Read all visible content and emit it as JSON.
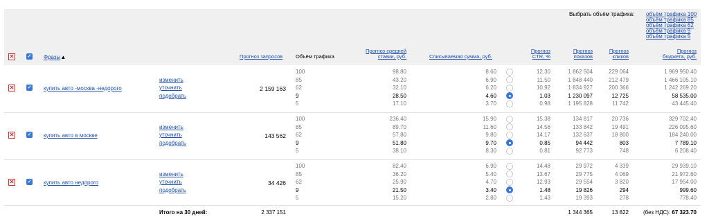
{
  "traffic_select": {
    "label": "Выбрать объём трафика:",
    "options": [
      "объём трафика 100",
      "объём трафика 85",
      "объём трафика 62",
      "объём трафика 9",
      "объём трафика 5"
    ]
  },
  "header": {
    "phrases": "Фразы",
    "sort_arrow": "▲",
    "requests": "Прогноз запросов",
    "traffic": "Объём трафика",
    "bid": [
      "Прогноз средней",
      "ставки, руб."
    ],
    "charged": "Списываемая сумма, руб.",
    "ctr": [
      "Прогноз",
      "CTR, %"
    ],
    "impressions": [
      "Прогноз",
      "показов"
    ],
    "clicks": [
      "Прогноз",
      "кликов"
    ],
    "budget": [
      "Прогноз",
      "бюджета, руб."
    ]
  },
  "actions": {
    "change": "изменить",
    "refine": "уточнить",
    "pick": "подобрать"
  },
  "phrases": [
    {
      "name": "купить авто -москва -недорого",
      "requests": "2 159 163",
      "rows": [
        {
          "traffic": "100",
          "bid": "98.80",
          "charged": "8.60",
          "ctr": "12.30",
          "impressions": "1 862 504",
          "clicks": "229 064",
          "budget": "1 969 950.40"
        },
        {
          "traffic": "85",
          "bid": "43.20",
          "charged": "6.90",
          "ctr": "11.50",
          "impressions": "1 848 440",
          "clicks": "212 479",
          "budget": "1 466 105.10"
        },
        {
          "traffic": "62",
          "bid": "32.10",
          "charged": "6.20",
          "ctr": "10.92",
          "impressions": "1 834 927",
          "clicks": "200 366",
          "budget": "1 242 269.20"
        },
        {
          "traffic": "9",
          "bid": "28.50",
          "charged": "4.60",
          "ctr": "1.03",
          "impressions": "1 230 097",
          "clicks": "12 725",
          "budget": "58 535.00"
        },
        {
          "traffic": "5",
          "bid": "17.10",
          "charged": "3.70",
          "ctr": "0.98",
          "impressions": "1 195 828",
          "clicks": "11 742",
          "budget": "43 445.40"
        }
      ]
    },
    {
      "name": "купить авто в москве",
      "requests": "143 562",
      "rows": [
        {
          "traffic": "100",
          "bid": "236.40",
          "charged": "15.90",
          "ctr": "15.38",
          "impressions": "134 817",
          "clicks": "20 736",
          "budget": "329 702.40"
        },
        {
          "traffic": "85",
          "bid": "89.70",
          "charged": "11.60",
          "ctr": "14.56",
          "impressions": "133 842",
          "clicks": "19 491",
          "budget": "226 095.60"
        },
        {
          "traffic": "62",
          "bid": "57.80",
          "charged": "9.80",
          "ctr": "14.17",
          "impressions": "132 637",
          "clicks": "18 800",
          "budget": "184 240.00"
        },
        {
          "traffic": "9",
          "bid": "51.80",
          "charged": "9.70",
          "ctr": "0.85",
          "impressions": "94 442",
          "clicks": "803",
          "budget": "7 789.10"
        },
        {
          "traffic": "5",
          "bid": "38.10",
          "charged": "8.30",
          "ctr": "0.81",
          "impressions": "92 773",
          "clicks": "748",
          "budget": "6 208.40"
        }
      ]
    },
    {
      "name": "купить авто недорого",
      "requests": "34 426",
      "rows": [
        {
          "traffic": "100",
          "bid": "82.40",
          "charged": "6.90",
          "ctr": "14.48",
          "impressions": "29 972",
          "clicks": "4 339",
          "budget": "29 939.10"
        },
        {
          "traffic": "85",
          "bid": "36.20",
          "charged": "5.40",
          "ctr": "13.67",
          "impressions": "29 775",
          "clicks": "4 069",
          "budget": "21 972.60"
        },
        {
          "traffic": "62",
          "bid": "25.90",
          "charged": "4.70",
          "ctr": "12.93",
          "impressions": "29 554",
          "clicks": "3 820",
          "budget": "17 954.00"
        },
        {
          "traffic": "9",
          "bid": "21.50",
          "charged": "3.40",
          "ctr": "1.48",
          "impressions": "19 826",
          "clicks": "294",
          "budget": "999.60"
        },
        {
          "traffic": "5",
          "bid": "15.20",
          "charged": "2.80",
          "ctr": "1.43",
          "impressions": "19 393",
          "clicks": "278",
          "budget": "778.40"
        }
      ]
    }
  ],
  "selected_row_index": 3,
  "totals": {
    "label": "Итого на 30 дней:",
    "requests": "2 337 151",
    "impressions": "1 344 365",
    "clicks": "13 822",
    "budget_prefix": "(без НДС):",
    "budget": "67 323.70"
  },
  "colors": {
    "link": "#1f4fa8",
    "checkbox": "#3a78d8",
    "remove": "#c43030",
    "header_bg": "#f0f0f0"
  }
}
